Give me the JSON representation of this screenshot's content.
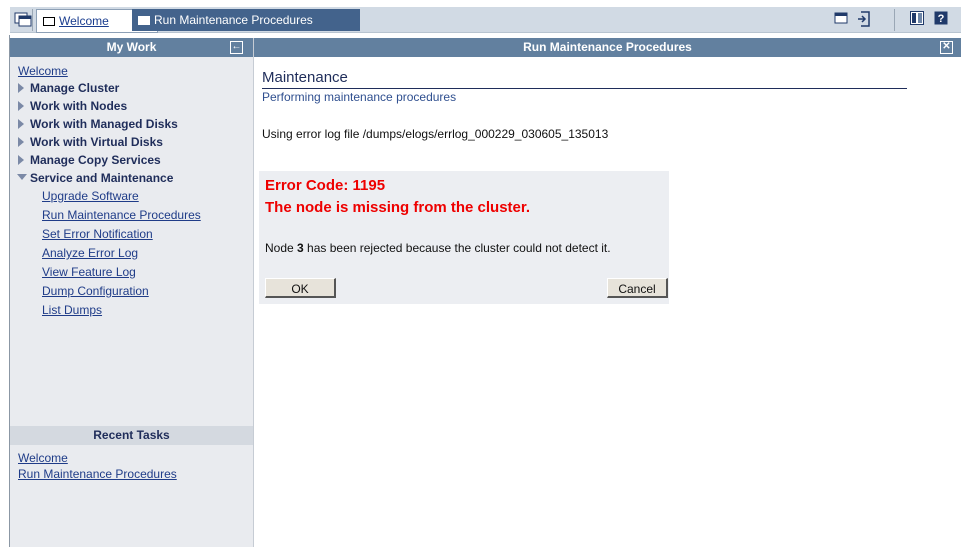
{
  "tabs": {
    "welcome": "Welcome",
    "run_maintenance": "Run Maintenance Procedures"
  },
  "sidebar": {
    "header": "My Work",
    "top_link": "Welcome",
    "sections": [
      {
        "label": "Manage Cluster",
        "expanded": false
      },
      {
        "label": "Work with Nodes",
        "expanded": false
      },
      {
        "label": "Work with Managed Disks",
        "expanded": false
      },
      {
        "label": "Work with Virtual Disks",
        "expanded": false
      },
      {
        "label": "Manage Copy Services",
        "expanded": false
      },
      {
        "label": "Service and Maintenance",
        "expanded": true
      }
    ],
    "sub_items": [
      "Upgrade Software",
      "Run Maintenance Procedures",
      "Set Error Notification",
      "Analyze Error Log",
      "View Feature Log",
      "Dump Configuration",
      "List Dumps"
    ]
  },
  "recent": {
    "header": "Recent Tasks",
    "items": [
      "Welcome",
      "Run Maintenance Procedures"
    ]
  },
  "main": {
    "header": "Run Maintenance Procedures",
    "title": "Maintenance",
    "subtitle": "Performing maintenance procedures",
    "logfile": "Using error log file /dumps/elogs/errlog_000229_030605_135013"
  },
  "dialog": {
    "error_code": "Error Code: 1195",
    "error_message": "The node is missing from the cluster.",
    "node_prefix": "Node ",
    "node_number": "3",
    "node_suffix": " has been rejected because the cluster could not detect it.",
    "ok_label": "OK",
    "cancel_label": "Cancel"
  },
  "icons": {
    "top_left": "windows-icon",
    "top_right": [
      "window-icon",
      "logout-icon",
      "tile-icon",
      "help-icon"
    ]
  },
  "colors": {
    "header": "#62809f",
    "active_tab": "#43638c",
    "error": "#ee0000",
    "link": "#1f3c88"
  }
}
